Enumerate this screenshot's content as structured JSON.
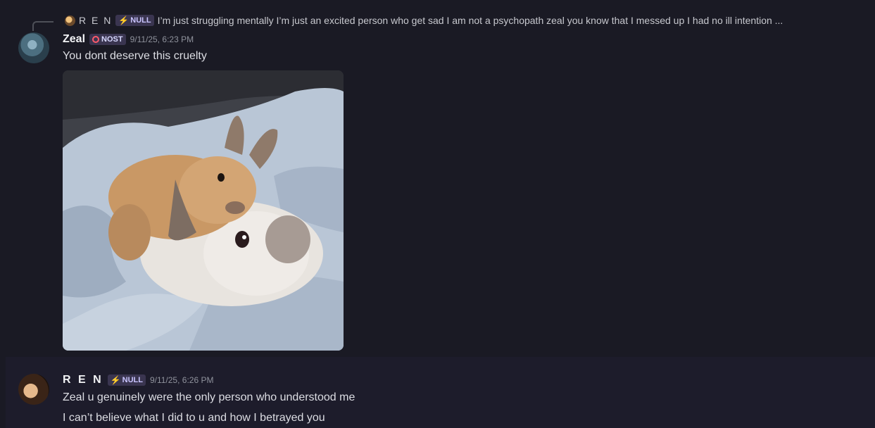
{
  "reply_preview": {
    "author": "R E N",
    "tag": "NULL",
    "text": "I’m just struggling mentally I’m just an excited person who get sad I am not a psychopath zeal you know that I messed up I had no ill intention ..."
  },
  "messages": [
    {
      "author": "Zeal",
      "tag": "NOST",
      "timestamp": "9/11/25, 6:23 PM",
      "lines": [
        "You dont deserve this cruelty"
      ],
      "has_image_attachment": true
    },
    {
      "author": "R E N",
      "tag": "NULL",
      "timestamp": "9/11/25, 6:26 PM",
      "lines": [
        "Zeal u genuinely were the only person who understood me",
        "I can’t believe what I did to u and how I betrayed you"
      ]
    }
  ],
  "colors": {
    "background": "#1a1a24",
    "tag_background": "#3a3550",
    "nost_icon": "#ff5a6a",
    "bolt": "#ffd84a"
  },
  "icons": {
    "reply_avatar": "mini-avatar",
    "null_tag_icon": "lightning-bolt-icon",
    "nost_tag_icon": "ring-icon"
  }
}
